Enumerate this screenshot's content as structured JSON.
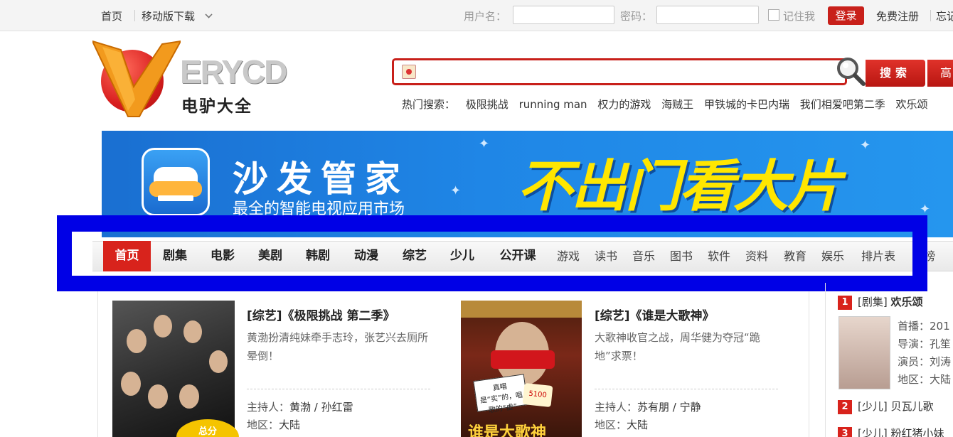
{
  "topbar": {
    "home": "首页",
    "mobile_download": "移动版下载",
    "username_label": "用户名：",
    "username_value": "",
    "password_label": "密码：",
    "password_value": "",
    "remember_label": "记住我",
    "login": "登录",
    "register": "免费注册",
    "forgot": "忘记"
  },
  "logo": {
    "text": "ERYCD",
    "subtitle": "电驴大全"
  },
  "search": {
    "value": "",
    "button": "搜索",
    "advanced": "高",
    "hot_label": "热门搜索：",
    "hot_terms": [
      "极限挑战",
      "running man",
      "权力的游戏",
      "海贼王",
      "甲铁城的卡巴内瑞",
      "我们相爱吧第二季",
      "欢乐颂"
    ]
  },
  "banner": {
    "title": "沙发管家",
    "subtitle": "最全的智能电视应用市场",
    "slogan": "不出门看大片"
  },
  "nav": {
    "items": [
      {
        "label": "首页",
        "active": true
      },
      {
        "label": "剧集"
      },
      {
        "label": "电影"
      },
      {
        "label": "美剧"
      },
      {
        "label": "韩剧"
      },
      {
        "label": "动漫"
      },
      {
        "label": "综艺"
      },
      {
        "label": "少儿"
      },
      {
        "label": "公开课"
      },
      {
        "label": "游戏"
      },
      {
        "label": "读书"
      },
      {
        "label": "音乐"
      },
      {
        "label": "图书"
      },
      {
        "label": "软件"
      },
      {
        "label": "资料"
      },
      {
        "label": "教育"
      },
      {
        "label": "娱乐"
      },
      {
        "label": "排片表"
      },
      {
        "label": "榜"
      }
    ]
  },
  "featured": [
    {
      "title": "[综艺]《极限挑战 第二季》",
      "desc": "黄渤扮清纯妹牵手志玲，张艺兴去厕所晕倒！",
      "host_label": "主持人：",
      "hosts": "黄渤 / 孙红雷",
      "region_label": "地区：",
      "region": "大陆",
      "badge": "总分"
    },
    {
      "title": "[综艺]《谁是大歌神》",
      "desc": "大歌神收官之战，周华健为夺冠“跪地”求票！",
      "host_label": "主持人：",
      "hosts": "苏有朋 / 宁静",
      "region_label": "地区：",
      "region": "大陆",
      "card_text": "真唱是“实”的，唱歌的“虚”",
      "score": "5100",
      "poster_title": "谁是大歌神"
    }
  ],
  "ranking": [
    {
      "num": "1",
      "category": "[剧集]",
      "title": "欢乐颂",
      "air_label": "首播：",
      "air": "201",
      "director_label": "导演：",
      "director": "孔笙",
      "cast_label": "演员：",
      "cast": "刘涛",
      "region_label": "地区：",
      "region": "大陆"
    },
    {
      "num": "2",
      "category": "[少儿]",
      "title": "贝瓦儿歌"
    },
    {
      "num": "3",
      "category": "[少儿]",
      "title": "粉红猪小妹"
    }
  ],
  "colors": {
    "brand_red": "#d8231c",
    "highlight_blue": "#0000e6",
    "banner_blue": "#1f86e6",
    "slogan_yellow": "#ffe600"
  }
}
